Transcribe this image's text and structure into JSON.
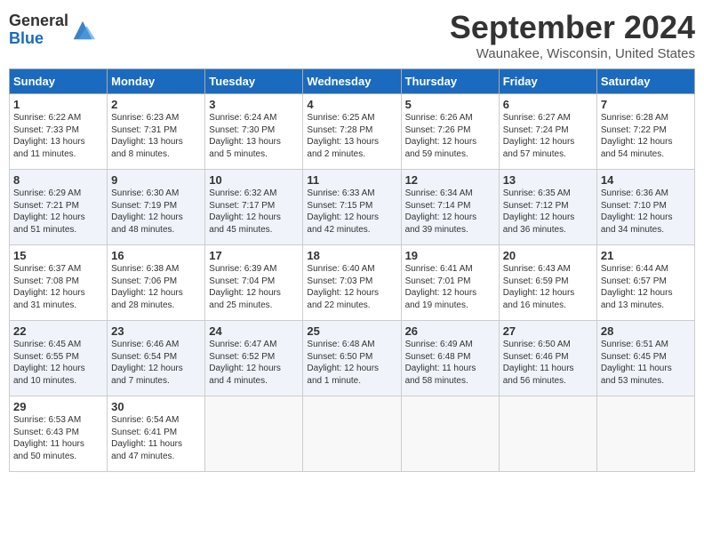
{
  "logo": {
    "general": "General",
    "blue": "Blue"
  },
  "title": "September 2024",
  "location": "Waunakee, Wisconsin, United States",
  "days_of_week": [
    "Sunday",
    "Monday",
    "Tuesday",
    "Wednesday",
    "Thursday",
    "Friday",
    "Saturday"
  ],
  "weeks": [
    [
      {
        "day": "1",
        "lines": [
          "Sunrise: 6:22 AM",
          "Sunset: 7:33 PM",
          "Daylight: 13 hours",
          "and 11 minutes."
        ]
      },
      {
        "day": "2",
        "lines": [
          "Sunrise: 6:23 AM",
          "Sunset: 7:31 PM",
          "Daylight: 13 hours",
          "and 8 minutes."
        ]
      },
      {
        "day": "3",
        "lines": [
          "Sunrise: 6:24 AM",
          "Sunset: 7:30 PM",
          "Daylight: 13 hours",
          "and 5 minutes."
        ]
      },
      {
        "day": "4",
        "lines": [
          "Sunrise: 6:25 AM",
          "Sunset: 7:28 PM",
          "Daylight: 13 hours",
          "and 2 minutes."
        ]
      },
      {
        "day": "5",
        "lines": [
          "Sunrise: 6:26 AM",
          "Sunset: 7:26 PM",
          "Daylight: 12 hours",
          "and 59 minutes."
        ]
      },
      {
        "day": "6",
        "lines": [
          "Sunrise: 6:27 AM",
          "Sunset: 7:24 PM",
          "Daylight: 12 hours",
          "and 57 minutes."
        ]
      },
      {
        "day": "7",
        "lines": [
          "Sunrise: 6:28 AM",
          "Sunset: 7:22 PM",
          "Daylight: 12 hours",
          "and 54 minutes."
        ]
      }
    ],
    [
      {
        "day": "8",
        "lines": [
          "Sunrise: 6:29 AM",
          "Sunset: 7:21 PM",
          "Daylight: 12 hours",
          "and 51 minutes."
        ]
      },
      {
        "day": "9",
        "lines": [
          "Sunrise: 6:30 AM",
          "Sunset: 7:19 PM",
          "Daylight: 12 hours",
          "and 48 minutes."
        ]
      },
      {
        "day": "10",
        "lines": [
          "Sunrise: 6:32 AM",
          "Sunset: 7:17 PM",
          "Daylight: 12 hours",
          "and 45 minutes."
        ]
      },
      {
        "day": "11",
        "lines": [
          "Sunrise: 6:33 AM",
          "Sunset: 7:15 PM",
          "Daylight: 12 hours",
          "and 42 minutes."
        ]
      },
      {
        "day": "12",
        "lines": [
          "Sunrise: 6:34 AM",
          "Sunset: 7:14 PM",
          "Daylight: 12 hours",
          "and 39 minutes."
        ]
      },
      {
        "day": "13",
        "lines": [
          "Sunrise: 6:35 AM",
          "Sunset: 7:12 PM",
          "Daylight: 12 hours",
          "and 36 minutes."
        ]
      },
      {
        "day": "14",
        "lines": [
          "Sunrise: 6:36 AM",
          "Sunset: 7:10 PM",
          "Daylight: 12 hours",
          "and 34 minutes."
        ]
      }
    ],
    [
      {
        "day": "15",
        "lines": [
          "Sunrise: 6:37 AM",
          "Sunset: 7:08 PM",
          "Daylight: 12 hours",
          "and 31 minutes."
        ]
      },
      {
        "day": "16",
        "lines": [
          "Sunrise: 6:38 AM",
          "Sunset: 7:06 PM",
          "Daylight: 12 hours",
          "and 28 minutes."
        ]
      },
      {
        "day": "17",
        "lines": [
          "Sunrise: 6:39 AM",
          "Sunset: 7:04 PM",
          "Daylight: 12 hours",
          "and 25 minutes."
        ]
      },
      {
        "day": "18",
        "lines": [
          "Sunrise: 6:40 AM",
          "Sunset: 7:03 PM",
          "Daylight: 12 hours",
          "and 22 minutes."
        ]
      },
      {
        "day": "19",
        "lines": [
          "Sunrise: 6:41 AM",
          "Sunset: 7:01 PM",
          "Daylight: 12 hours",
          "and 19 minutes."
        ]
      },
      {
        "day": "20",
        "lines": [
          "Sunrise: 6:43 AM",
          "Sunset: 6:59 PM",
          "Daylight: 12 hours",
          "and 16 minutes."
        ]
      },
      {
        "day": "21",
        "lines": [
          "Sunrise: 6:44 AM",
          "Sunset: 6:57 PM",
          "Daylight: 12 hours",
          "and 13 minutes."
        ]
      }
    ],
    [
      {
        "day": "22",
        "lines": [
          "Sunrise: 6:45 AM",
          "Sunset: 6:55 PM",
          "Daylight: 12 hours",
          "and 10 minutes."
        ]
      },
      {
        "day": "23",
        "lines": [
          "Sunrise: 6:46 AM",
          "Sunset: 6:54 PM",
          "Daylight: 12 hours",
          "and 7 minutes."
        ]
      },
      {
        "day": "24",
        "lines": [
          "Sunrise: 6:47 AM",
          "Sunset: 6:52 PM",
          "Daylight: 12 hours",
          "and 4 minutes."
        ]
      },
      {
        "day": "25",
        "lines": [
          "Sunrise: 6:48 AM",
          "Sunset: 6:50 PM",
          "Daylight: 12 hours",
          "and 1 minute."
        ]
      },
      {
        "day": "26",
        "lines": [
          "Sunrise: 6:49 AM",
          "Sunset: 6:48 PM",
          "Daylight: 11 hours",
          "and 58 minutes."
        ]
      },
      {
        "day": "27",
        "lines": [
          "Sunrise: 6:50 AM",
          "Sunset: 6:46 PM",
          "Daylight: 11 hours",
          "and 56 minutes."
        ]
      },
      {
        "day": "28",
        "lines": [
          "Sunrise: 6:51 AM",
          "Sunset: 6:45 PM",
          "Daylight: 11 hours",
          "and 53 minutes."
        ]
      }
    ],
    [
      {
        "day": "29",
        "lines": [
          "Sunrise: 6:53 AM",
          "Sunset: 6:43 PM",
          "Daylight: 11 hours",
          "and 50 minutes."
        ]
      },
      {
        "day": "30",
        "lines": [
          "Sunrise: 6:54 AM",
          "Sunset: 6:41 PM",
          "Daylight: 11 hours",
          "and 47 minutes."
        ]
      },
      {
        "day": "",
        "lines": []
      },
      {
        "day": "",
        "lines": []
      },
      {
        "day": "",
        "lines": []
      },
      {
        "day": "",
        "lines": []
      },
      {
        "day": "",
        "lines": []
      }
    ]
  ]
}
